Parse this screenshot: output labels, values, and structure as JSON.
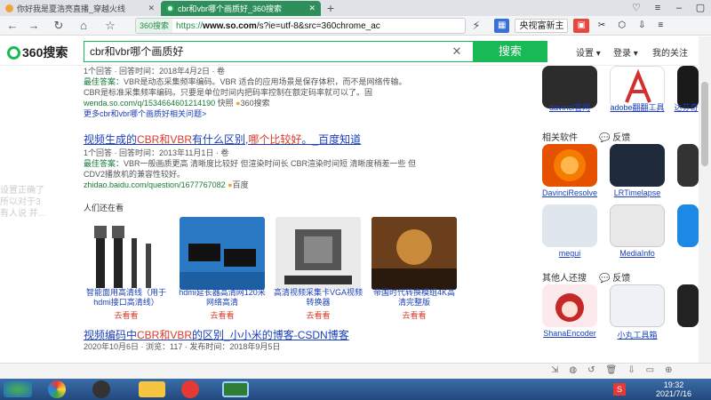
{
  "tabs": [
    {
      "title": "你好我是夏浩亮直播_穿越火线",
      "active": false,
      "color": "#f0a33c"
    },
    {
      "title": "cbr和vbr哪个画质好_360搜索",
      "active": true,
      "color": "#19b955"
    }
  ],
  "address": {
    "badge": "360搜索",
    "scheme": "https://",
    "domain": "www.so.com",
    "path": "/s?ie=utf-8&src=360chrome_ac"
  },
  "toolbar_right": {
    "search_placeholder": "央视富新主"
  },
  "header": {
    "logo": "360搜索",
    "query": "cbr和vbr哪个画质好",
    "search_button": "搜索",
    "settings": "设置",
    "login": "登录",
    "follow": "我的关注"
  },
  "results": {
    "r1_date": "1个回答 · 回答时间：2018年4月2日 · 卷",
    "r1_best_label": "最佳答案：",
    "r1_best": "VBR是动态采集频率编码。VBR 适合的应用场景是保存体积，而不是网络传输。",
    "r1_line2": "CBR是标准采集频率编码。只要是单位时间内把码率控制在额定码率就可以了。固",
    "r1_url": "wenda.so.com/q/1534664601214190",
    "r1_snap": "快照",
    "r1_src": "360搜索",
    "r1_more": "更多cbr和vbr哪个画质好相关问题>",
    "r2_title_a": "视频生成的",
    "r2_title_hl": "CBR和VBR",
    "r2_title_b": "有什么区别",
    "r2_title_hl2": "哪个比较好",
    "r2_title_c": "。_百度知道",
    "r2_date": "1个回答 · 回答时间：2013年11月1日 · 卷",
    "r2_best_label": "最佳答案：",
    "r2_best": "VBR一般画质更高 清晰度比较好 但渲染时间长 CBR渲染时间短 清晰度稍差一些 但",
    "r2_line2": "CDV2播放机的兼容性较好。",
    "r2_url": "zhidao.baidu.com/question/1677767082",
    "r2_src": "百度",
    "video_head": "人们还在看",
    "videos": [
      {
        "cap": "智能面用高清线（用于hdmi接口高清线）",
        "sub": "去看看"
      },
      {
        "cap": "hdmi延长器高清网120米网络高清",
        "sub": "去看看"
      },
      {
        "cap": "高清视频采集卡VGA视频转换器",
        "sub": "去看看"
      },
      {
        "cap": "帝国时代转换模组4K高清完整版",
        "sub": "去看看"
      }
    ],
    "r3_title_a": "视频编码中",
    "r3_title_hl": "CBR和VBR",
    "r3_title_b": "的区别_小小米的博客-CSDN博客",
    "r3_date": "2020年10月6日 · 浏览：117 · 发布时间：2018年9月5日"
  },
  "side": {
    "apps_row1": [
      "davinci官网",
      "adobe翻翻工具",
      "达芬奇"
    ],
    "related_head": "相关软件",
    "feedback": "反馈",
    "apps_row2": [
      "DavinciResolve",
      "LRTimelapse",
      ""
    ],
    "apps_row3": [
      "megui",
      "MediaInfo",
      ""
    ],
    "others_head": "其他人还搜",
    "apps_row4": [
      "ShanaEncoder",
      "小丸工具箱",
      ""
    ]
  },
  "ghost": [
    "设置正确了",
    "所以对于3",
    "有人说 并..."
  ],
  "taskbar": {
    "time": "19:32",
    "date": "2021/7/16"
  }
}
